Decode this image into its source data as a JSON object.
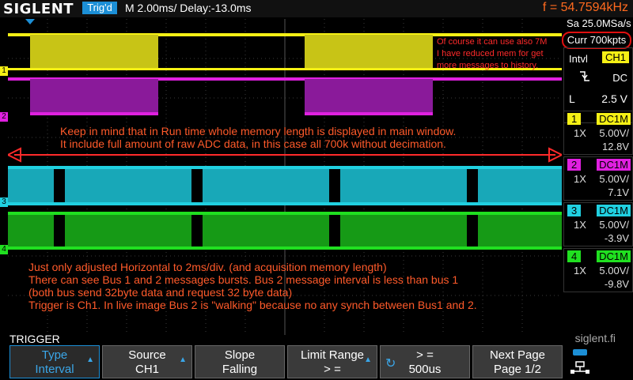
{
  "header": {
    "logo": "SIGLENT",
    "trig_status": "Trig'd",
    "timebase": "M 2.00ms/ Delay:-13.0ms",
    "frequency": "f = 54.7594kHz"
  },
  "acquisition": {
    "sample_rate": "Sa 25.0MSa/s",
    "memory": "Curr 700kpts"
  },
  "trigger_panel": {
    "type": "Intvl",
    "source": "CH1",
    "coupling": "DC",
    "level_label": "L",
    "level_value": "2.5 V"
  },
  "channels": [
    {
      "num": "1",
      "coupling": "DC1M",
      "probe": "1X",
      "vdiv": "5.00V/",
      "offset": "12.8V",
      "color": "#f5f015"
    },
    {
      "num": "2",
      "coupling": "DC1M",
      "probe": "1X",
      "vdiv": "5.00V/",
      "offset": "7.1V",
      "color": "#e020e0"
    },
    {
      "num": "3",
      "coupling": "DC1M",
      "probe": "1X",
      "vdiv": "5.00V/",
      "offset": "-3.9V",
      "color": "#20d0e0"
    },
    {
      "num": "4",
      "coupling": "DC1M",
      "probe": "1X",
      "vdiv": "5.00V/",
      "offset": "-9.8V",
      "color": "#20e020"
    }
  ],
  "annotations": {
    "note_top_right": [
      "Of course it can use also 7M",
      " I have reduced mem for get",
      "more messages to history."
    ],
    "note_middle": [
      "Keep in mind that in Run time whole memory length is displayed in main window.",
      "It include full amount of raw ADC data, in this case all 700k without decimation."
    ],
    "note_bottom": [
      "Just only adjusted Horizontal to 2ms/div.  (and acquisition memory length)",
      "There can see Bus 1 and 2 messages bursts. Bus 2 message interval is less than bus 1",
      "(both bus send 32byte data and request 32 byte data)",
      "Trigger is Ch1. In live image Bus 2 is \"walking\" because no any synch between Bus1 and 2."
    ]
  },
  "menu": {
    "title": "TRIGGER",
    "watermark": "siglent.fi",
    "softkeys": [
      {
        "line1": "Type",
        "line2": "Interval"
      },
      {
        "line1": "Source",
        "line2": "CH1"
      },
      {
        "line1": "Slope",
        "line2": "Falling"
      },
      {
        "line1": "Limit Range",
        "line2": "> ="
      },
      {
        "line1": "> =",
        "line2": "500us"
      },
      {
        "line1": "Next Page",
        "line2": "Page 1/2"
      }
    ]
  },
  "colors": {
    "accent": "#1c8fd6",
    "annotation": "#ff5a2a",
    "highlight": "#e01010"
  },
  "icons": [
    "trigger-falling-edge-icon",
    "knob-icon",
    "network-icon"
  ]
}
